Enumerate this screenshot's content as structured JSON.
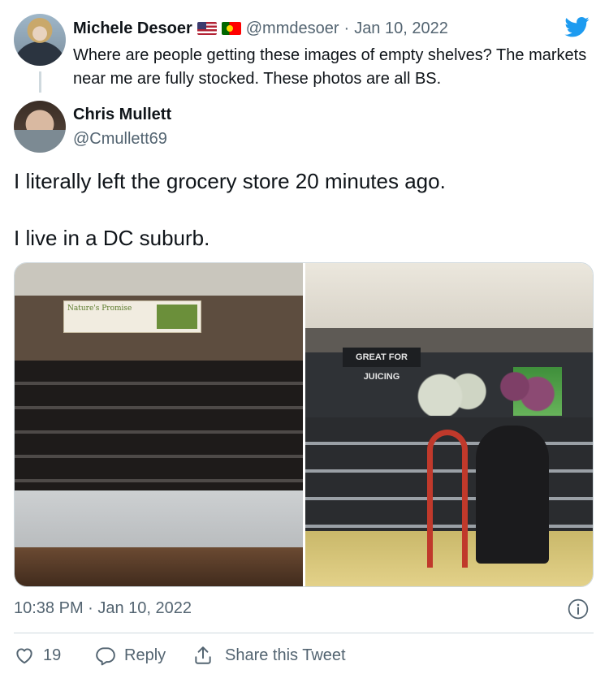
{
  "quoted_tweet": {
    "author_name": "Michele Desoer",
    "flags": [
      "us-flag-icon",
      "portugal-flag-icon"
    ],
    "handle": "@mmdesoer",
    "separator": "·",
    "date": "Jan 10, 2022",
    "text": "Where are people getting these images of empty shelves?  The markets near me are fully stocked.  These photos are all BS."
  },
  "tweet": {
    "author_name": "Chris Mullett",
    "handle": "@Cmullett69",
    "paragraphs": [
      "I literally left the grocery store 20 minutes ago.",
      "I live in a DC suburb."
    ],
    "photo_left_sign": "Nature's Promise",
    "photo_right_sign": "GREAT FOR JUICING",
    "timestamp": "10:38 PM · Jan 10, 2022"
  },
  "actions": {
    "like_count": "19",
    "reply_label": "Reply",
    "share_label": "Share this Tweet"
  },
  "colors": {
    "brand": "#1d9bf0",
    "text": "#0f1419",
    "secondary": "#536471",
    "divider": "#cfd9de"
  }
}
